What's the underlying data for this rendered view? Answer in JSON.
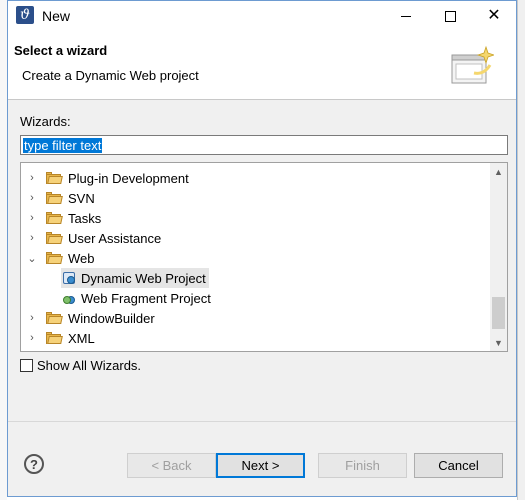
{
  "window": {
    "title": "New"
  },
  "header": {
    "title": "Select a wizard",
    "description": "Create a Dynamic Web project"
  },
  "wizards": {
    "label": "Wizards:",
    "filter_value": "type filter text",
    "show_all_label": "Show All Wizards.",
    "show_all_checked": false,
    "tree": [
      {
        "label": "Plug-in Development",
        "expanded": false
      },
      {
        "label": "SVN",
        "expanded": false
      },
      {
        "label": "Tasks",
        "expanded": false
      },
      {
        "label": "User Assistance",
        "expanded": false
      },
      {
        "label": "Web",
        "expanded": true
      },
      {
        "label": "Dynamic Web Project",
        "child": true,
        "selected": true
      },
      {
        "label": "Web Fragment Project",
        "child": true
      },
      {
        "label": "WindowBuilder",
        "expanded": false
      },
      {
        "label": "XML",
        "expanded": false
      }
    ]
  },
  "buttons": {
    "back": "< Back",
    "next": "Next >",
    "finish": "Finish",
    "cancel": "Cancel",
    "help": "?"
  },
  "icons": {
    "app": "eclipse-icon",
    "folder": "folder-icon",
    "project": "web-project-icon"
  },
  "colors": {
    "selection": "#0078d7",
    "default_button_border": "#0078d7"
  }
}
